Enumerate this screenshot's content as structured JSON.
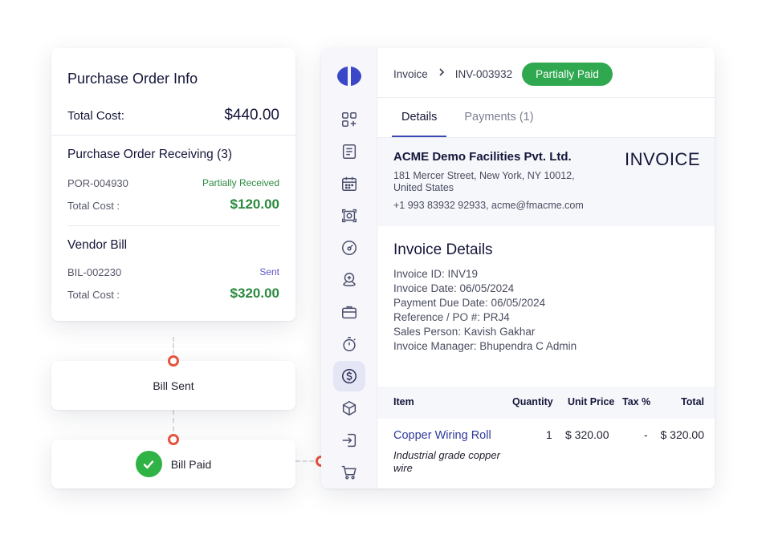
{
  "purchase_order": {
    "title": "Purchase Order Info",
    "total_label": "Total Cost:",
    "total_value": "$440.00",
    "receiving": {
      "title": "Purchase Order Receiving (3)",
      "id": "POR-004930",
      "status": "Partially Received",
      "status_color": "#2b8a3e",
      "cost_label": "Total Cost :",
      "cost": "$120.00"
    },
    "vendor_bill": {
      "title": "Vendor Bill",
      "id": "BIL-002230",
      "status": "Sent",
      "status_color": "#5b57c9",
      "cost_label": "Total Cost :",
      "cost": "$320.00"
    }
  },
  "timeline": {
    "bill_sent": "Bill Sent",
    "bill_paid": "Bill Paid",
    "node_color": "#e5533d",
    "check_color": "#2fb344"
  },
  "sidebar": {
    "icons": [
      "logo-icon",
      "apps-icon",
      "document-icon",
      "calendar-icon",
      "scan-icon",
      "gauge-icon",
      "location-icon",
      "briefcase-icon",
      "stopwatch-icon",
      "dollar-icon",
      "box-icon",
      "login-icon",
      "cart-icon"
    ],
    "active": "dollar-icon"
  },
  "invoice": {
    "breadcrumb": [
      "Invoice",
      "INV-003932"
    ],
    "status_badge": "Partially Paid",
    "badge_color": "#2fa84f",
    "tabs": [
      "Details",
      "Payments (1)"
    ],
    "active_tab": "Details",
    "company": {
      "name": "ACME Demo Facilities Pvt. Ltd.",
      "address": "181 Mercer Street, New York, NY 10012, United States",
      "contact": "+1 993 83932 92933, acme@fmacme.com"
    },
    "doc_type": "INVOICE",
    "details_title": "Invoice Details",
    "details": [
      "Invoice ID: INV19",
      "Invoice Date: 06/05/2024",
      "Payment Due Date: 06/05/2024",
      "Reference / PO #: PRJ4",
      "Sales Person: Kavish Gakhar",
      "Invoice Manager: Bhupendra C Admin"
    ],
    "table": {
      "headers": [
        "Item",
        "Quantity",
        "Unit Price",
        "Tax %",
        "Total"
      ],
      "rows": [
        {
          "item": "Copper Wiring Roll",
          "description": "Industrial grade copper wire",
          "quantity": "1",
          "unit_price": "$ 320.00",
          "tax": "-",
          "total": "$ 320.00"
        }
      ]
    }
  }
}
